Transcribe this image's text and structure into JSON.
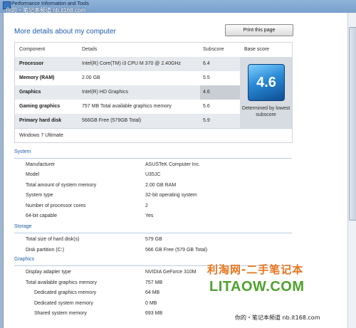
{
  "window": {
    "title": "Performance Information and Tools"
  },
  "watermark": {
    "top_text": "你的・笔记本频道 nb.it168.com",
    "cn_text": "利淘网-二手笔记本",
    "en_text": "LITAOW.COM",
    "bottom_text": "你的・笔记本频道 nb.it168.com"
  },
  "page": {
    "title": "More details about my computer",
    "print_button": "Print this page"
  },
  "scores": {
    "headers": {
      "component": "Component",
      "details": "Details",
      "subscore": "Subscore",
      "base": "Base score"
    },
    "rows": [
      {
        "component": "Processor",
        "details": "Intel(R) Core(TM) i3 CPU M 370 @ 2.40GHz",
        "subscore": "6.4"
      },
      {
        "component": "Memory (RAM)",
        "details": "2.00 GB",
        "subscore": "5.5"
      },
      {
        "component": "Graphics",
        "details": "Intel(R) HD Graphics",
        "subscore": "4.6"
      },
      {
        "component": "Gaming graphics",
        "details": "757 MB Total available graphics memory",
        "subscore": "5.6"
      },
      {
        "component": "Primary hard disk",
        "details": "566GB Free (579GB Total)",
        "subscore": "5.9"
      }
    ],
    "base_score": "4.6",
    "base_caption": "Determined by lowest subscore",
    "os": "Windows 7 Ultimate"
  },
  "system": {
    "heading": "System",
    "items": [
      {
        "label": "Manufacturer",
        "value": "ASUSTeK Computer Inc."
      },
      {
        "label": "Model",
        "value": "U35JC"
      },
      {
        "label": "Total amount of system memory",
        "value": "2.00 GB RAM"
      },
      {
        "label": "System type",
        "value": "32-bit operating system"
      },
      {
        "label": "Number of processor cores",
        "value": "2"
      },
      {
        "label": "64-bit capable",
        "value": "Yes"
      }
    ]
  },
  "storage": {
    "heading": "Storage",
    "items": [
      {
        "label": "Total size of hard disk(s)",
        "value": "579 GB"
      },
      {
        "label": "Disk partition (C:)",
        "value": "566 GB Free (579 GB Total)"
      }
    ]
  },
  "graphics": {
    "heading": "Graphics",
    "items": [
      {
        "label": "Display adapter type",
        "value": "NVIDIA GeForce 310M"
      },
      {
        "label": "Total available graphics memory",
        "value": "757 MB"
      },
      {
        "label": "Dedicated graphics memory",
        "value": "64 MB"
      },
      {
        "label": "Dedicated system memory",
        "value": "0 MB"
      },
      {
        "label": "Shared system memory",
        "value": "693 MB"
      }
    ]
  }
}
